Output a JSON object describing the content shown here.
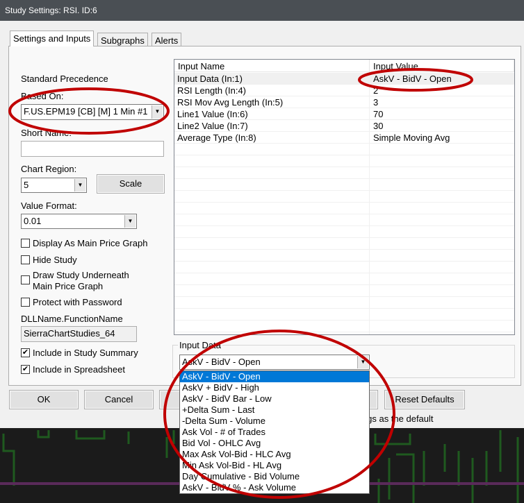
{
  "title": "Study Settings: RSI. ID:6",
  "tabs": [
    "Settings and Inputs",
    "Subgraphs",
    "Alerts"
  ],
  "left": {
    "standard_precedence": "Standard Precedence",
    "based_on_label": "Based On:",
    "based_on_value": "F.US.EPM19 [CB] [M]  1 Min  #1",
    "short_name_label": "Short Name:",
    "short_name_value": "",
    "chart_region_label": "Chart Region:",
    "chart_region_value": "5",
    "scale_label": "Scale",
    "value_format_label": "Value Format:",
    "value_format_value": "0.01",
    "checkboxes": [
      {
        "label": "Display As Main Price Graph",
        "checked": false
      },
      {
        "label": "Hide Study",
        "checked": false
      },
      {
        "label": "Draw Study Underneath Main Price Graph",
        "checked": false
      },
      {
        "label": "Protect with Password",
        "checked": false
      }
    ],
    "dll_label": "DLLName.FunctionName",
    "dll_value": "SierraChartStudies_64",
    "include_summary": "Include in Study Summary",
    "include_spreadsheet": "Include in Spreadsheet"
  },
  "table": {
    "headers": [
      "Input Name",
      "Input Value"
    ],
    "rows": [
      [
        "Input Data   (In:1)",
        "AskV - BidV - Open"
      ],
      [
        "RSI Length   (In:4)",
        "2"
      ],
      [
        "RSI Mov Avg Length   (In:5)",
        "3"
      ],
      [
        "Line1 Value   (In:6)",
        "70"
      ],
      [
        "Line2 Value   (In:7)",
        "30"
      ],
      [
        "Average Type   (In:8)",
        "Simple Moving Avg"
      ]
    ]
  },
  "input_group": {
    "label": "Input Data",
    "value": "AskV - BidV - Open",
    "options": [
      "AskV - BidV - Open",
      "AskV + BidV - High",
      "AskV - BidV Bar - Low",
      "+Delta Sum - Last",
      "-Delta Sum - Volume",
      "Ask Vol - # of Trades",
      "Bid Vol - OHLC Avg",
      "Max Ask Vol-Bid - HLC Avg",
      "Min Ask Vol-Bid - HL Avg",
      "Day Cumulative - Bid Volume",
      "AskV - BidV % - Ask Volume"
    ]
  },
  "buttons": {
    "ok": "OK",
    "cancel": "Cancel",
    "reset": "Reset Defaults"
  },
  "default_note": "ings as the default",
  "colors": {
    "accent": "#0078d7",
    "annotation": "#c00000"
  }
}
